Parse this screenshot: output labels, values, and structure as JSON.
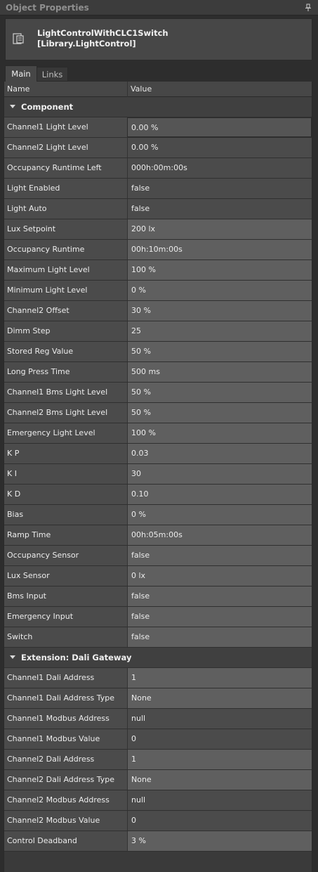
{
  "panel": {
    "title": "Object Properties"
  },
  "object": {
    "name_line1": "LightControlWithCLC1Switch",
    "name_line2": "[Library.LightControl]"
  },
  "tabs": [
    {
      "label": "Main"
    },
    {
      "label": "Links"
    }
  ],
  "grid": {
    "col_name": "Name",
    "col_value": "Value"
  },
  "groups": [
    {
      "label": "Component",
      "rows": [
        {
          "name": "Channel1 Light Level",
          "value": "0.00 %",
          "state": "selected"
        },
        {
          "name": "Channel2 Light Level",
          "value": "0.00 %",
          "state": "readonly"
        },
        {
          "name": "Occupancy Runtime Left",
          "value": "000h:00m:00s",
          "state": "readonly"
        },
        {
          "name": "Light Enabled",
          "value": "false",
          "state": "readonly"
        },
        {
          "name": "Light Auto",
          "value": "false",
          "state": "readonly"
        },
        {
          "name": "Lux Setpoint",
          "value": "200 lx",
          "state": "editable"
        },
        {
          "name": "Occupancy Runtime",
          "value": "00h:10m:00s",
          "state": "editable"
        },
        {
          "name": "Maximum Light Level",
          "value": "100 %",
          "state": "editable"
        },
        {
          "name": "Minimum Light Level",
          "value": "0 %",
          "state": "editable"
        },
        {
          "name": "Channel2 Offset",
          "value": "30 %",
          "state": "editable"
        },
        {
          "name": "Dimm Step",
          "value": "25",
          "state": "editable"
        },
        {
          "name": "Stored Reg Value",
          "value": "50 %",
          "state": "editable"
        },
        {
          "name": "Long Press Time",
          "value": "500 ms",
          "state": "editable"
        },
        {
          "name": "Channel1 Bms Light Level",
          "value": "50 %",
          "state": "editable"
        },
        {
          "name": "Channel2 Bms Light Level",
          "value": "50 %",
          "state": "editable"
        },
        {
          "name": "Emergency Light Level",
          "value": "100 %",
          "state": "editable"
        },
        {
          "name": "K P",
          "value": "0.03",
          "state": "editable"
        },
        {
          "name": "K I",
          "value": "30",
          "state": "editable"
        },
        {
          "name": "K D",
          "value": "0.10",
          "state": "editable"
        },
        {
          "name": "Bias",
          "value": "0 %",
          "state": "editable"
        },
        {
          "name": "Ramp Time",
          "value": "00h:05m:00s",
          "state": "editable"
        },
        {
          "name": "Occupancy Sensor",
          "value": "false",
          "state": "editable"
        },
        {
          "name": "Lux Sensor",
          "value": "0 lx",
          "state": "editable"
        },
        {
          "name": "Bms Input",
          "value": "false",
          "state": "editable"
        },
        {
          "name": "Emergency Input",
          "value": "false",
          "state": "editable"
        },
        {
          "name": "Switch",
          "value": "false",
          "state": "editable"
        }
      ]
    },
    {
      "label": "Extension: Dali Gateway",
      "rows": [
        {
          "name": "Channel1 Dali Address",
          "value": "1",
          "state": "editable"
        },
        {
          "name": "Channel1 Dali Address Type",
          "value": "None",
          "state": "editable"
        },
        {
          "name": "Channel1 Modbus Address",
          "value": "null",
          "state": "readonly"
        },
        {
          "name": "Channel1 Modbus Value",
          "value": "0",
          "state": "readonly"
        },
        {
          "name": "Channel2 Dali Address",
          "value": "1",
          "state": "editable"
        },
        {
          "name": "Channel2 Dali Address Type",
          "value": "None",
          "state": "editable"
        },
        {
          "name": "Channel2 Modbus Address",
          "value": "null",
          "state": "readonly"
        },
        {
          "name": "Channel2 Modbus Value",
          "value": "0",
          "state": "readonly"
        },
        {
          "name": "Control Deadband",
          "value": "3 %",
          "state": "editable"
        }
      ]
    }
  ],
  "colors": {
    "background": "#2d2d2d",
    "name_cell": "#4b4b4b",
    "editable_value": "#5f5f5f",
    "group_header": "#404040"
  },
  "icons": {
    "pin": "pin-icon",
    "object": "object-icon",
    "collapse": "chevron-down-icon"
  }
}
